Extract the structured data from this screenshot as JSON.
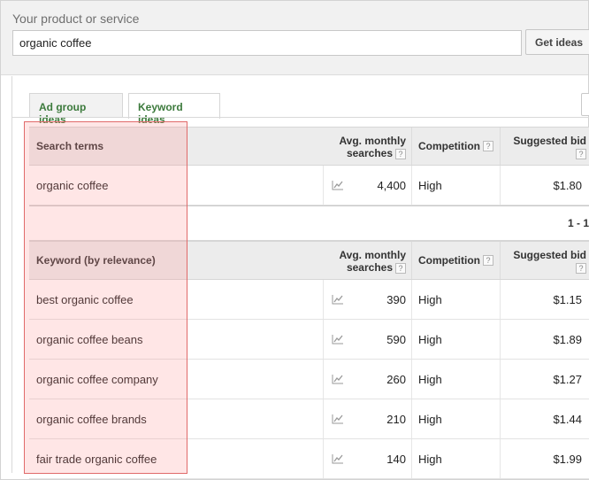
{
  "topbar": {
    "label": "Your product or service",
    "search_value": "organic coffee",
    "search_placeholder": "",
    "get_ideas_label": "Get ideas"
  },
  "tabs": [
    {
      "label": "Ad group ideas",
      "active": false
    },
    {
      "label": "Keyword ideas",
      "active": true
    }
  ],
  "columns": {
    "avg_monthly_line1": "Avg. monthly",
    "avg_monthly_line2": "searches",
    "competition": "Competition",
    "suggested_bid": "Suggested bid",
    "help": "?"
  },
  "search_terms": {
    "header": "Search terms",
    "rows": [
      {
        "term": "organic coffee",
        "searches": "4,400",
        "competition": "High",
        "bid": "$1.80"
      }
    ],
    "pager": "1 - 1"
  },
  "keyword_ideas": {
    "header": "Keyword (by relevance)",
    "rows": [
      {
        "term": "best organic coffee",
        "searches": "390",
        "competition": "High",
        "bid": "$1.15"
      },
      {
        "term": "organic coffee beans",
        "searches": "590",
        "competition": "High",
        "bid": "$1.89"
      },
      {
        "term": "organic coffee company",
        "searches": "260",
        "competition": "High",
        "bid": "$1.27"
      },
      {
        "term": "organic coffee brands",
        "searches": "210",
        "competition": "High",
        "bid": "$1.44"
      },
      {
        "term": "fair trade organic coffee",
        "searches": "140",
        "competition": "High",
        "bid": "$1.99"
      }
    ]
  },
  "colors": {
    "tab_text": "#3c7a3c",
    "highlight_border": "#e06a6a",
    "header_bg": "#ececec"
  },
  "icons": {
    "trend": "trend-chart-icon",
    "help": "help-question-icon"
  }
}
